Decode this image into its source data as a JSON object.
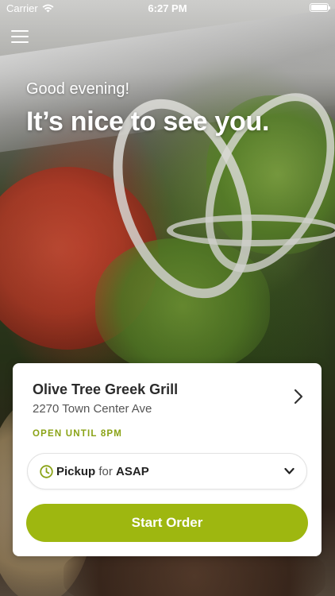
{
  "status_bar": {
    "carrier": "Carrier",
    "time": "6:27 PM",
    "wifi_icon": "wifi-icon",
    "battery_icon": "battery-icon"
  },
  "header": {
    "menu_icon": "hamburger-menu-icon"
  },
  "hero": {
    "greeting": "Good evening!",
    "headline": "It’s nice to see you."
  },
  "store_card": {
    "name": "Olive Tree Greek Grill",
    "address": "2270 Town Center Ave",
    "status": "OPEN UNTIL 8PM",
    "chevron_icon": "chevron-right-icon",
    "pickup": {
      "mode": "Pickup",
      "connector": "for",
      "time": "ASAP",
      "clock_icon": "clock-icon",
      "dropdown_icon": "chevron-down-icon"
    },
    "cta_label": "Start Order"
  },
  "colors": {
    "accent": "#9eb710",
    "status_green": "#8aa316",
    "card_bg": "#ffffff"
  }
}
